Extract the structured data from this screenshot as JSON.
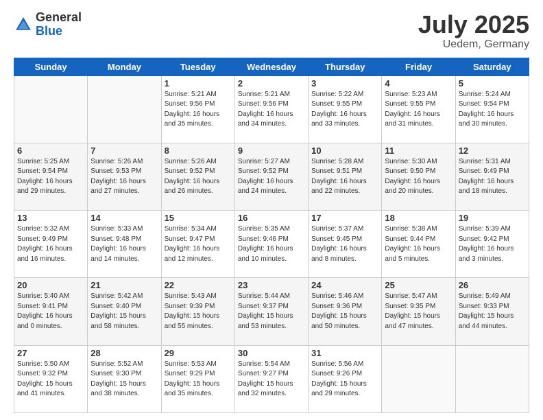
{
  "header": {
    "logo_general": "General",
    "logo_blue": "Blue",
    "month": "July 2025",
    "location": "Uedem, Germany"
  },
  "weekdays": [
    "Sunday",
    "Monday",
    "Tuesday",
    "Wednesday",
    "Thursday",
    "Friday",
    "Saturday"
  ],
  "weeks": [
    [
      {
        "day": "",
        "info": ""
      },
      {
        "day": "",
        "info": ""
      },
      {
        "day": "1",
        "info": "Sunrise: 5:21 AM\nSunset: 9:56 PM\nDaylight: 16 hours\nand 35 minutes."
      },
      {
        "day": "2",
        "info": "Sunrise: 5:21 AM\nSunset: 9:56 PM\nDaylight: 16 hours\nand 34 minutes."
      },
      {
        "day": "3",
        "info": "Sunrise: 5:22 AM\nSunset: 9:55 PM\nDaylight: 16 hours\nand 33 minutes."
      },
      {
        "day": "4",
        "info": "Sunrise: 5:23 AM\nSunset: 9:55 PM\nDaylight: 16 hours\nand 31 minutes."
      },
      {
        "day": "5",
        "info": "Sunrise: 5:24 AM\nSunset: 9:54 PM\nDaylight: 16 hours\nand 30 minutes."
      }
    ],
    [
      {
        "day": "6",
        "info": "Sunrise: 5:25 AM\nSunset: 9:54 PM\nDaylight: 16 hours\nand 29 minutes."
      },
      {
        "day": "7",
        "info": "Sunrise: 5:26 AM\nSunset: 9:53 PM\nDaylight: 16 hours\nand 27 minutes."
      },
      {
        "day": "8",
        "info": "Sunrise: 5:26 AM\nSunset: 9:52 PM\nDaylight: 16 hours\nand 26 minutes."
      },
      {
        "day": "9",
        "info": "Sunrise: 5:27 AM\nSunset: 9:52 PM\nDaylight: 16 hours\nand 24 minutes."
      },
      {
        "day": "10",
        "info": "Sunrise: 5:28 AM\nSunset: 9:51 PM\nDaylight: 16 hours\nand 22 minutes."
      },
      {
        "day": "11",
        "info": "Sunrise: 5:30 AM\nSunset: 9:50 PM\nDaylight: 16 hours\nand 20 minutes."
      },
      {
        "day": "12",
        "info": "Sunrise: 5:31 AM\nSunset: 9:49 PM\nDaylight: 16 hours\nand 18 minutes."
      }
    ],
    [
      {
        "day": "13",
        "info": "Sunrise: 5:32 AM\nSunset: 9:49 PM\nDaylight: 16 hours\nand 16 minutes."
      },
      {
        "day": "14",
        "info": "Sunrise: 5:33 AM\nSunset: 9:48 PM\nDaylight: 16 hours\nand 14 minutes."
      },
      {
        "day": "15",
        "info": "Sunrise: 5:34 AM\nSunset: 9:47 PM\nDaylight: 16 hours\nand 12 minutes."
      },
      {
        "day": "16",
        "info": "Sunrise: 5:35 AM\nSunset: 9:46 PM\nDaylight: 16 hours\nand 10 minutes."
      },
      {
        "day": "17",
        "info": "Sunrise: 5:37 AM\nSunset: 9:45 PM\nDaylight: 16 hours\nand 8 minutes."
      },
      {
        "day": "18",
        "info": "Sunrise: 5:38 AM\nSunset: 9:44 PM\nDaylight: 16 hours\nand 5 minutes."
      },
      {
        "day": "19",
        "info": "Sunrise: 5:39 AM\nSunset: 9:42 PM\nDaylight: 16 hours\nand 3 minutes."
      }
    ],
    [
      {
        "day": "20",
        "info": "Sunrise: 5:40 AM\nSunset: 9:41 PM\nDaylight: 16 hours\nand 0 minutes."
      },
      {
        "day": "21",
        "info": "Sunrise: 5:42 AM\nSunset: 9:40 PM\nDaylight: 15 hours\nand 58 minutes."
      },
      {
        "day": "22",
        "info": "Sunrise: 5:43 AM\nSunset: 9:39 PM\nDaylight: 15 hours\nand 55 minutes."
      },
      {
        "day": "23",
        "info": "Sunrise: 5:44 AM\nSunset: 9:37 PM\nDaylight: 15 hours\nand 53 minutes."
      },
      {
        "day": "24",
        "info": "Sunrise: 5:46 AM\nSunset: 9:36 PM\nDaylight: 15 hours\nand 50 minutes."
      },
      {
        "day": "25",
        "info": "Sunrise: 5:47 AM\nSunset: 9:35 PM\nDaylight: 15 hours\nand 47 minutes."
      },
      {
        "day": "26",
        "info": "Sunrise: 5:49 AM\nSunset: 9:33 PM\nDaylight: 15 hours\nand 44 minutes."
      }
    ],
    [
      {
        "day": "27",
        "info": "Sunrise: 5:50 AM\nSunset: 9:32 PM\nDaylight: 15 hours\nand 41 minutes."
      },
      {
        "day": "28",
        "info": "Sunrise: 5:52 AM\nSunset: 9:30 PM\nDaylight: 15 hours\nand 38 minutes."
      },
      {
        "day": "29",
        "info": "Sunrise: 5:53 AM\nSunset: 9:29 PM\nDaylight: 15 hours\nand 35 minutes."
      },
      {
        "day": "30",
        "info": "Sunrise: 5:54 AM\nSunset: 9:27 PM\nDaylight: 15 hours\nand 32 minutes."
      },
      {
        "day": "31",
        "info": "Sunrise: 5:56 AM\nSunset: 9:26 PM\nDaylight: 15 hours\nand 29 minutes."
      },
      {
        "day": "",
        "info": ""
      },
      {
        "day": "",
        "info": ""
      }
    ]
  ]
}
